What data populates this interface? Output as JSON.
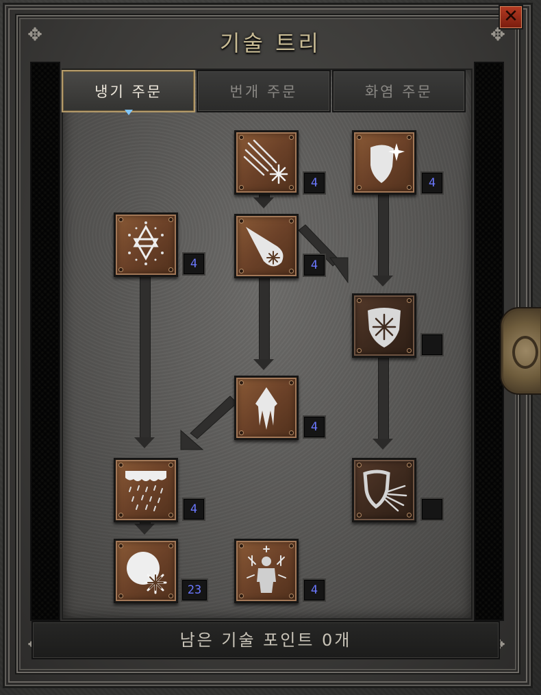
{
  "window": {
    "title": "기술 트리",
    "close_label": "✕"
  },
  "tabs": [
    {
      "label": "냉기 주문",
      "active": true
    },
    {
      "label": "번개 주문",
      "active": false
    },
    {
      "label": "화염 주문",
      "active": false
    }
  ],
  "skills": [
    {
      "id": "ice-shards",
      "icon": "ice-shards-icon",
      "level": "4"
    },
    {
      "id": "frost-shield",
      "icon": "frost-shield-icon",
      "level": "4"
    },
    {
      "id": "snowflake-star",
      "icon": "snowflake-star-icon",
      "level": "4"
    },
    {
      "id": "frost-bolt",
      "icon": "frost-bolt-icon",
      "level": "4"
    },
    {
      "id": "frozen-shield",
      "icon": "frozen-shield-icon",
      "level": ""
    },
    {
      "id": "ice-spike",
      "icon": "ice-spike-icon",
      "level": "4"
    },
    {
      "id": "blizzard",
      "icon": "blizzard-icon",
      "level": "4"
    },
    {
      "id": "chilling-ward",
      "icon": "chilling-ward-icon",
      "level": ""
    },
    {
      "id": "frozen-orb",
      "icon": "frozen-orb-icon",
      "level": "23"
    },
    {
      "id": "frost-armor",
      "icon": "frost-armor-icon",
      "level": "4"
    }
  ],
  "footer": {
    "remaining_points": "남은 기술 포인트 0개"
  },
  "colors": {
    "level_text": "#6b78ff",
    "title_text": "#c8bb94",
    "active_tab_border": "#b39a6a"
  }
}
